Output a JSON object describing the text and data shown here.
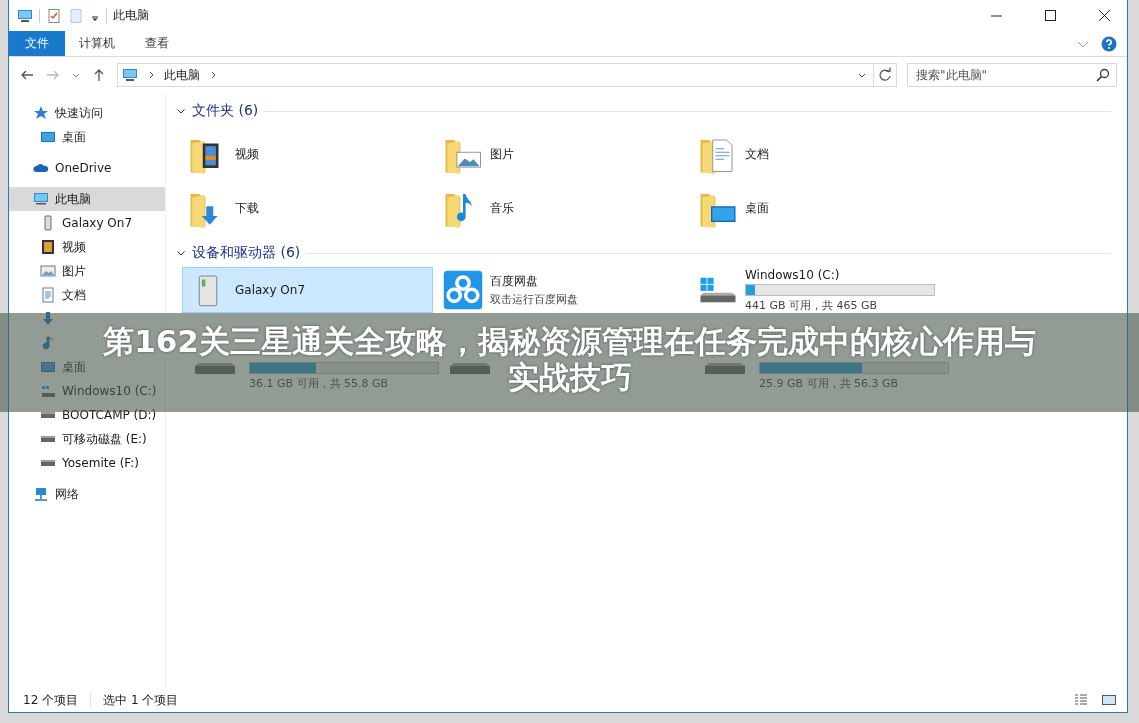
{
  "window": {
    "title": "此电脑"
  },
  "ribbon": {
    "tabs": [
      {
        "label": "文件",
        "selected": true
      },
      {
        "label": "计算机",
        "selected": false
      },
      {
        "label": "查看",
        "selected": false
      }
    ]
  },
  "address": {
    "path": [
      "此电脑"
    ]
  },
  "search": {
    "placeholder": "搜索\"此电脑\""
  },
  "sidebar": {
    "items": [
      {
        "kind": "star",
        "label": "快速访问",
        "selected": false,
        "children": [
          {
            "kind": "desktop",
            "label": "桌面",
            "selected": false
          }
        ]
      },
      {
        "kind": "cloud",
        "label": "OneDrive",
        "selected": false
      },
      {
        "kind": "pc",
        "label": "此电脑",
        "selected": true,
        "children": [
          {
            "kind": "phone",
            "label": "Galaxy On7",
            "selected": false
          },
          {
            "kind": "video",
            "label": "视频",
            "selected": false
          },
          {
            "kind": "picture",
            "label": "图片",
            "selected": false
          },
          {
            "kind": "document",
            "label": "文档",
            "selected": false
          },
          {
            "kind": "download",
            "selected": false
          },
          {
            "kind": "music",
            "selected": false
          },
          {
            "kind": "desktop",
            "label": "桌面",
            "selected": false
          },
          {
            "kind": "drive-win",
            "label": "Windows10 (C:)",
            "selected": false
          },
          {
            "kind": "drive",
            "label": "BOOTCAMP (D:)",
            "selected": false
          },
          {
            "kind": "drive",
            "label": "可移动磁盘 (E:)",
            "selected": false
          },
          {
            "kind": "drive",
            "label": "Yosemite (F:)",
            "selected": false
          }
        ]
      },
      {
        "kind": "network",
        "label": "网络",
        "selected": false
      }
    ]
  },
  "groups": [
    {
      "kind": "folders",
      "title": "文件夹 (6)",
      "expanded": true,
      "items": [
        {
          "kind": "video",
          "name": "视频",
          "selected": false
        },
        {
          "kind": "picture",
          "name": "图片",
          "selected": false
        },
        {
          "kind": "document",
          "name": "文档",
          "selected": false
        },
        {
          "kind": "download",
          "name": "下载",
          "selected": false
        },
        {
          "kind": "music",
          "name": "音乐",
          "selected": false
        },
        {
          "kind": "desktop",
          "name": "桌面",
          "selected": false
        }
      ]
    },
    {
      "kind": "devices",
      "title": "设备和驱动器 (6)",
      "expanded": true,
      "items": [
        {
          "kind": "phone",
          "name": "Galaxy On7",
          "selected": true
        },
        {
          "kind": "app",
          "name": "百度网盘",
          "subtitle": "双击运行百度网盘",
          "selected": false
        },
        {
          "kind": "drive-win",
          "name": "Windows10 (C:)",
          "level": 0.05,
          "free": "441 GB 可用，共 465 GB",
          "selected": false
        },
        {
          "kind": "drive",
          "level": 0.35,
          "free": "36.1 GB 可用，共 55.8 GB"
        },
        {
          "kind": "drive"
        },
        {
          "kind": "drive",
          "level": 0.54,
          "free": "25.9 GB 可用，共 56.3 GB"
        }
      ]
    }
  ],
  "status_bar": {
    "count": "12 个项目",
    "selection": "选中 1 个项目"
  },
  "overlay_caption": {
    "lines": [
      "第162关三星通关全攻略，揭秘资源管理在任务完成中的核心作用与",
      "实战技巧"
    ]
  }
}
